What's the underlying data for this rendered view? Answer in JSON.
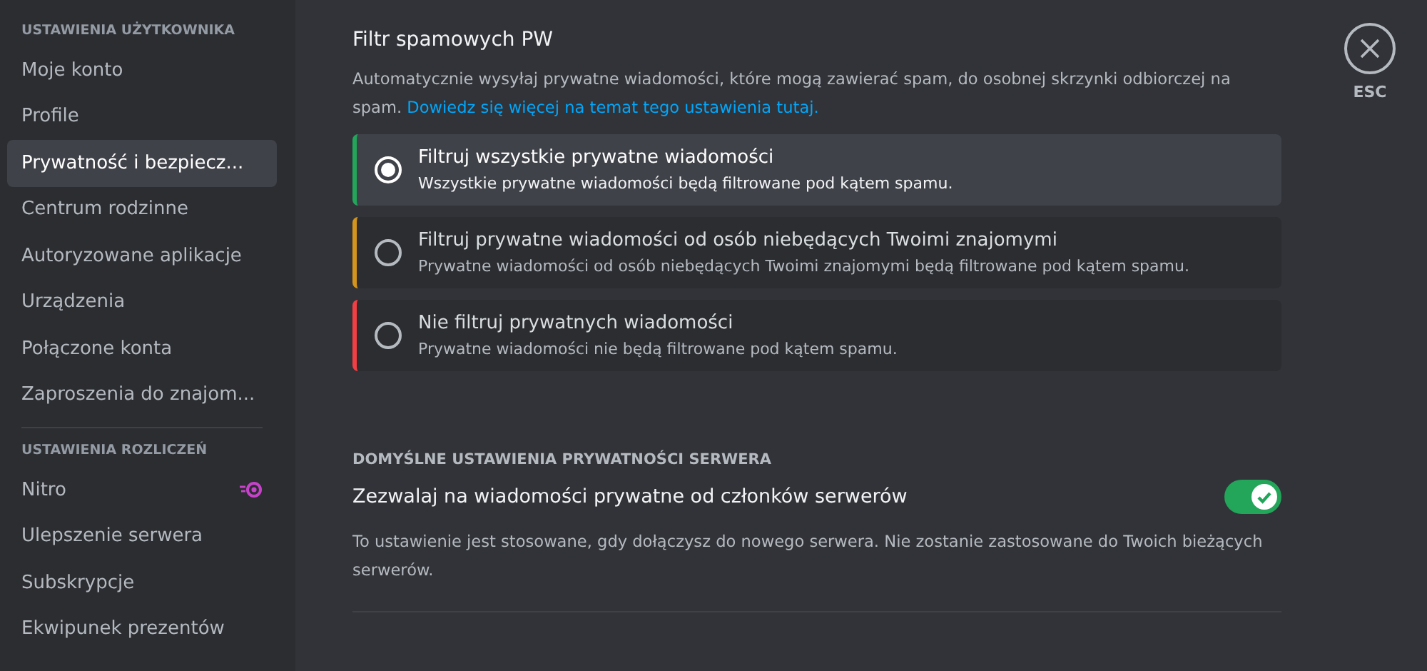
{
  "sidebar": {
    "sections": [
      {
        "header": "USTAWIENIA UŻYTKOWNIKA",
        "items": [
          {
            "label": "Moje konto",
            "selected": false
          },
          {
            "label": "Profile",
            "selected": false
          },
          {
            "label": "Prywatność i bezpiecz...",
            "selected": true
          },
          {
            "label": "Centrum rodzinne",
            "selected": false
          },
          {
            "label": "Autoryzowane aplikacje",
            "selected": false
          },
          {
            "label": "Urządzenia",
            "selected": false
          },
          {
            "label": "Połączone konta",
            "selected": false
          },
          {
            "label": "Zaproszenia do znajom...",
            "selected": false
          }
        ]
      },
      {
        "header": "USTAWIENIA ROZLICZEŃ",
        "items": [
          {
            "label": "Nitro",
            "selected": false,
            "badge": true
          },
          {
            "label": "Ulepszenie serwera",
            "selected": false
          },
          {
            "label": "Subskrypcje",
            "selected": false
          },
          {
            "label": "Ekwipunek prezentów",
            "selected": false
          }
        ]
      }
    ]
  },
  "spam_filter": {
    "title": "Filtr spamowych PW",
    "description": "Automatycznie wysyłaj prywatne wiadomości, które mogą zawierać spam, do osobnej skrzynki odbiorczej na spam.",
    "link": "Dowiedz się więcej na temat tego ustawienia tutaj.",
    "options": [
      {
        "title": "Filtruj wszystkie prywatne wiadomości",
        "description": "Wszystkie prywatne wiadomości będą filtrowane pod kątem spamu.",
        "selected": true,
        "color": "#23a55a"
      },
      {
        "title": "Filtruj prywatne wiadomości od osób niebędących Twoimi znajomymi",
        "description": "Prywatne wiadomości od osób niebędących Twoimi znajomymi będą filtrowane pod kątem spamu.",
        "selected": false,
        "color": "#d4951c"
      },
      {
        "title": "Nie filtruj prywatnych wiadomości",
        "description": "Prywatne wiadomości nie będą filtrowane pod kątem spamu.",
        "selected": false,
        "color": "#f23f43"
      }
    ]
  },
  "server_privacy": {
    "header": "DOMYŚLNE USTAWIENIA PRYWATNOŚCI SERWERA",
    "setting": {
      "label": "Zezwalaj na wiadomości prywatne od członków serwerów",
      "on": true,
      "description": "To ustawienie jest stosowane, gdy dołączysz do nowego serwera. Nie zostanie zastosowane do Twoich bieżących serwerów."
    }
  },
  "close": {
    "label": "ESC"
  }
}
